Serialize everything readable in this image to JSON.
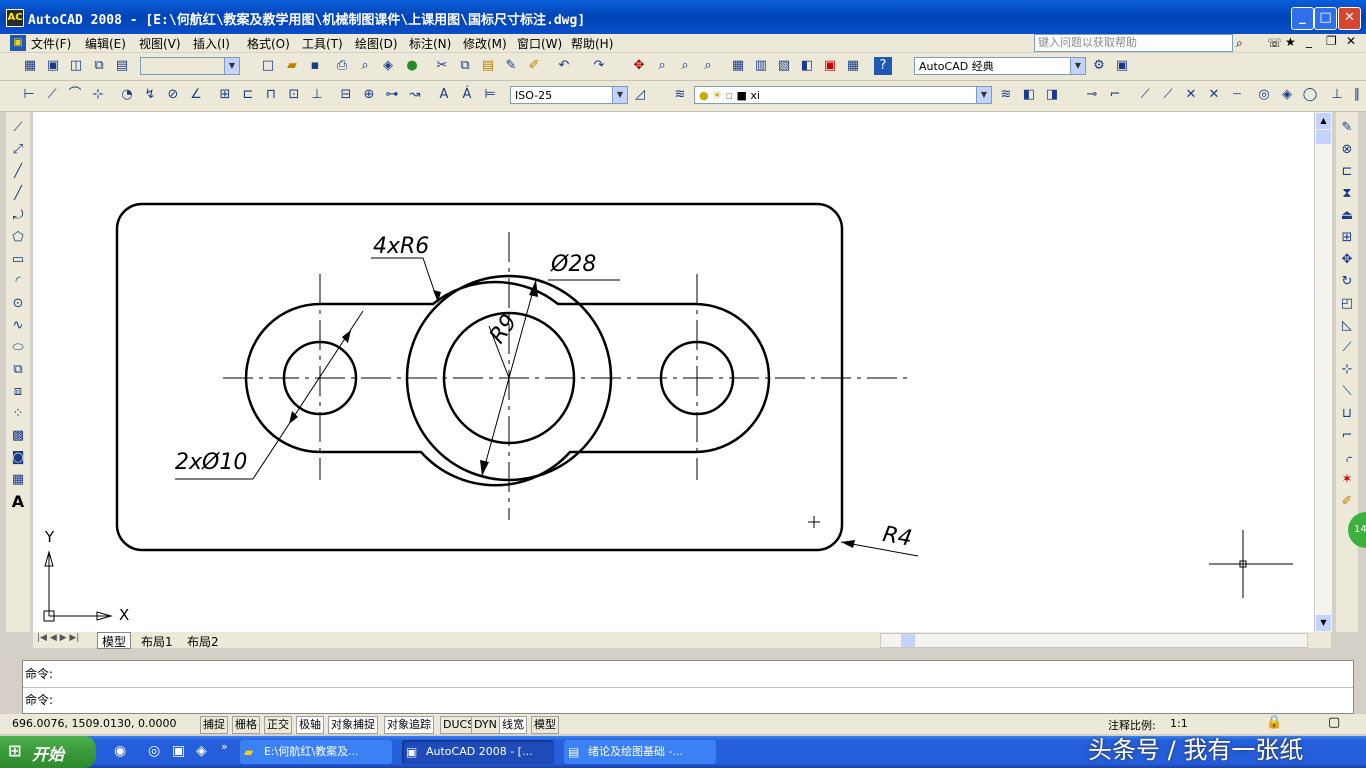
{
  "window": {
    "title": "AutoCAD 2008 - [E:\\何航红\\教案及教学用图\\机械制图课件\\上课用图\\国标尺寸标注.dwg]",
    "app_icon_text": "AC",
    "minimize": "_",
    "maximize": "□",
    "close": "✕"
  },
  "menu": {
    "items": [
      "文件(F)",
      "编辑(E)",
      "视图(V)",
      "插入(I)",
      "格式(O)",
      "工具(T)",
      "绘图(D)",
      "标注(N)",
      "修改(M)",
      "窗口(W)",
      "帮助(H)"
    ],
    "help_placeholder": "键入问题以获取帮助"
  },
  "toolbars": {
    "workspace": "AutoCAD 经典",
    "dim_style": "ISO-25",
    "layer": "xi"
  },
  "drawing": {
    "dim_fillet_top": "4xR6",
    "dim_big_dia": "Ø28",
    "dim_inner_radius": "R9",
    "dim_small_holes": "2xØ10",
    "dim_corner_radius": "R4",
    "ucs_x": "X",
    "ucs_y": "Y"
  },
  "layout_tabs": [
    "模型",
    "布局1",
    "布局2"
  ],
  "command": {
    "line1": "命令:",
    "line2": "命令:"
  },
  "status": {
    "coords": "696.0076, 1509.0130, 0.0000",
    "buttons": [
      "捕捉",
      "栅格",
      "正交",
      "极轴",
      "对象捕捉",
      "对象追踪",
      "DUCS",
      "DYN",
      "线宽",
      "模型"
    ],
    "annotation_scale_label": "注释比例:",
    "annotation_scale_value": "1:1"
  },
  "taskbar": {
    "start": "开始",
    "tasks": [
      "E:\\何航红\\教案及...",
      "AutoCAD 2008 - [...",
      "绪论及绘图基础 -..."
    ],
    "watermark": "头条号 / 我有一张纸"
  },
  "colors": {
    "titlebar": "#0a4ec8",
    "canvas": "#ffffff",
    "drawing_lines": "#000000",
    "taskbar": "#245edb",
    "start_button": "#3a9a3a"
  }
}
